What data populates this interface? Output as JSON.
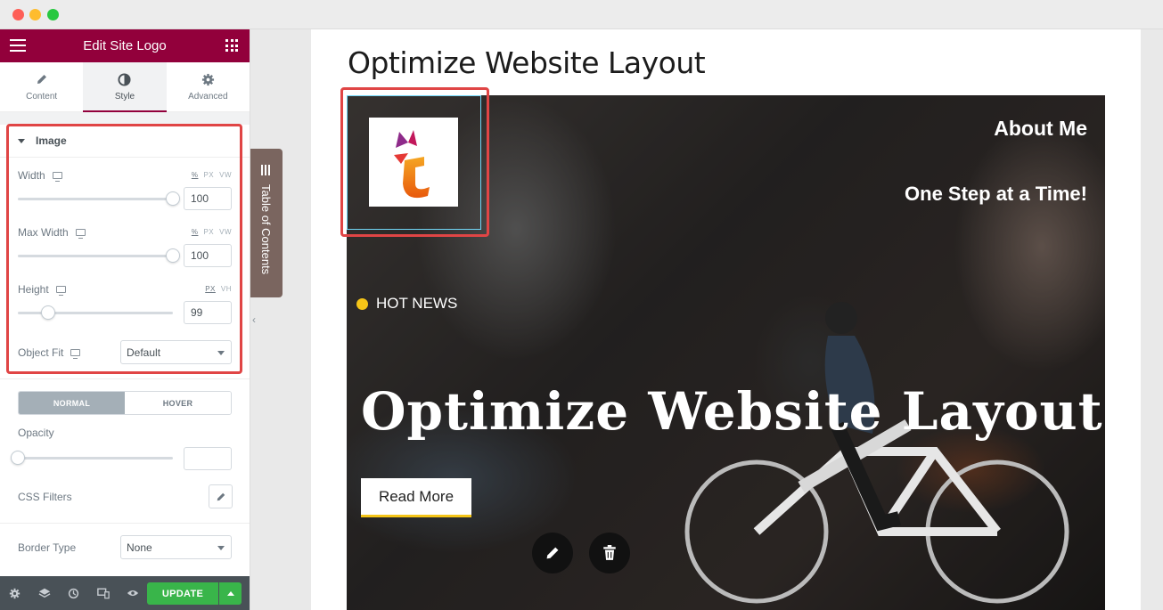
{
  "panel": {
    "title": "Edit Site Logo",
    "tabs": [
      {
        "label": "Content",
        "icon": "pencil-icon"
      },
      {
        "label": "Style",
        "icon": "contrast-icon"
      },
      {
        "label": "Advanced",
        "icon": "gear-icon"
      }
    ],
    "section_title": "Image",
    "width": {
      "label": "Width",
      "units": [
        "%",
        "PX",
        "VW"
      ],
      "value": "100",
      "level_percent": 100
    },
    "max_width": {
      "label": "Max Width",
      "units": [
        "%",
        "PX",
        "VW"
      ],
      "value": "100",
      "level_percent": 100
    },
    "height": {
      "label": "Height",
      "units": [
        "PX",
        "VH"
      ],
      "value": "99",
      "level_percent": 19
    },
    "object_fit": {
      "label": "Object Fit",
      "value": "Default"
    },
    "state_toggle": {
      "normal": "NORMAL",
      "hover": "HOVER"
    },
    "opacity": {
      "label": "Opacity",
      "value": "",
      "level_percent": 0
    },
    "css_filters": {
      "label": "CSS Filters"
    },
    "border_type": {
      "label": "Border Type",
      "value": "None"
    },
    "update_label": "UPDATE"
  },
  "toc": {
    "label": "Table of Contents"
  },
  "preview": {
    "page_title": "Optimize Website Layout",
    "about": "About Me",
    "tagline": "One Step at a Time!",
    "hot_news": "HOT NEWS",
    "hero_title": "Optimize Website Layout",
    "read_more": "Read More"
  },
  "colors": {
    "brand": "#92003b",
    "update": "#39b54a",
    "highlight": "#e04545",
    "accent": "#f5c518"
  }
}
